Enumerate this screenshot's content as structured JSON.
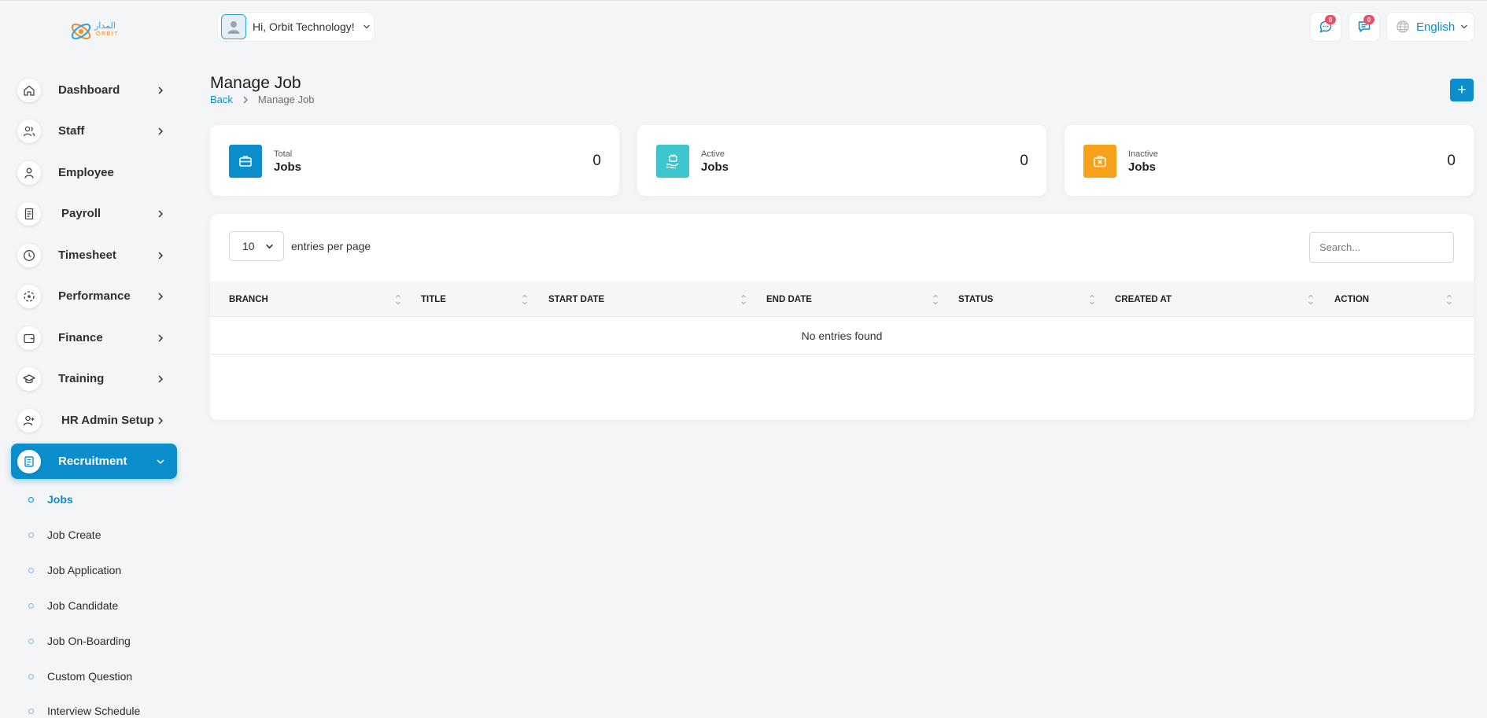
{
  "logo": {
    "arabic": "المدار",
    "english": "ORBIT"
  },
  "header": {
    "greeting": "Hi, Orbit Technology!",
    "chat_badge": "0",
    "message_badge": "0",
    "language": "English"
  },
  "sidebar": {
    "items": [
      {
        "label": "Dashboard",
        "icon": "home-icon"
      },
      {
        "label": "Staff",
        "icon": "users-icon"
      },
      {
        "label": "Employee",
        "icon": "user-icon"
      },
      {
        "label": "Payroll",
        "icon": "receipt-icon"
      },
      {
        "label": "Timesheet",
        "icon": "clock-icon"
      },
      {
        "label": "Performance",
        "icon": "performance-icon"
      },
      {
        "label": "Finance",
        "icon": "wallet-icon"
      },
      {
        "label": "Training",
        "icon": "graduation-cap-icon"
      },
      {
        "label": "HR Admin Setup",
        "icon": "user-plus-icon"
      },
      {
        "label": "Recruitment",
        "icon": "clipboard-icon"
      }
    ],
    "submenu": [
      {
        "label": "Jobs"
      },
      {
        "label": "Job Create"
      },
      {
        "label": "Job Application"
      },
      {
        "label": "Job Candidate"
      },
      {
        "label": "Job On-Boarding"
      },
      {
        "label": "Custom Question"
      },
      {
        "label": "Interview Schedule"
      }
    ]
  },
  "page": {
    "title": "Manage Job",
    "breadcrumb_back": "Back",
    "breadcrumb_current": "Manage Job",
    "add_label": "+"
  },
  "stats": [
    {
      "small": "Total",
      "big": "Jobs",
      "count": "0",
      "color": "#0b8ecb"
    },
    {
      "small": "Active",
      "big": "Jobs",
      "count": "0",
      "color": "#3ec6cf"
    },
    {
      "small": "Inactive",
      "big": "Jobs",
      "count": "0",
      "color": "#f8a21b"
    }
  ],
  "table": {
    "entries_value": "10",
    "entries_label": "entries per page",
    "search_placeholder": "Search...",
    "columns": [
      "BRANCH",
      "TITLE",
      "START DATE",
      "END DATE",
      "STATUS",
      "CREATED AT",
      "ACTION"
    ],
    "empty_message": "No entries found"
  }
}
